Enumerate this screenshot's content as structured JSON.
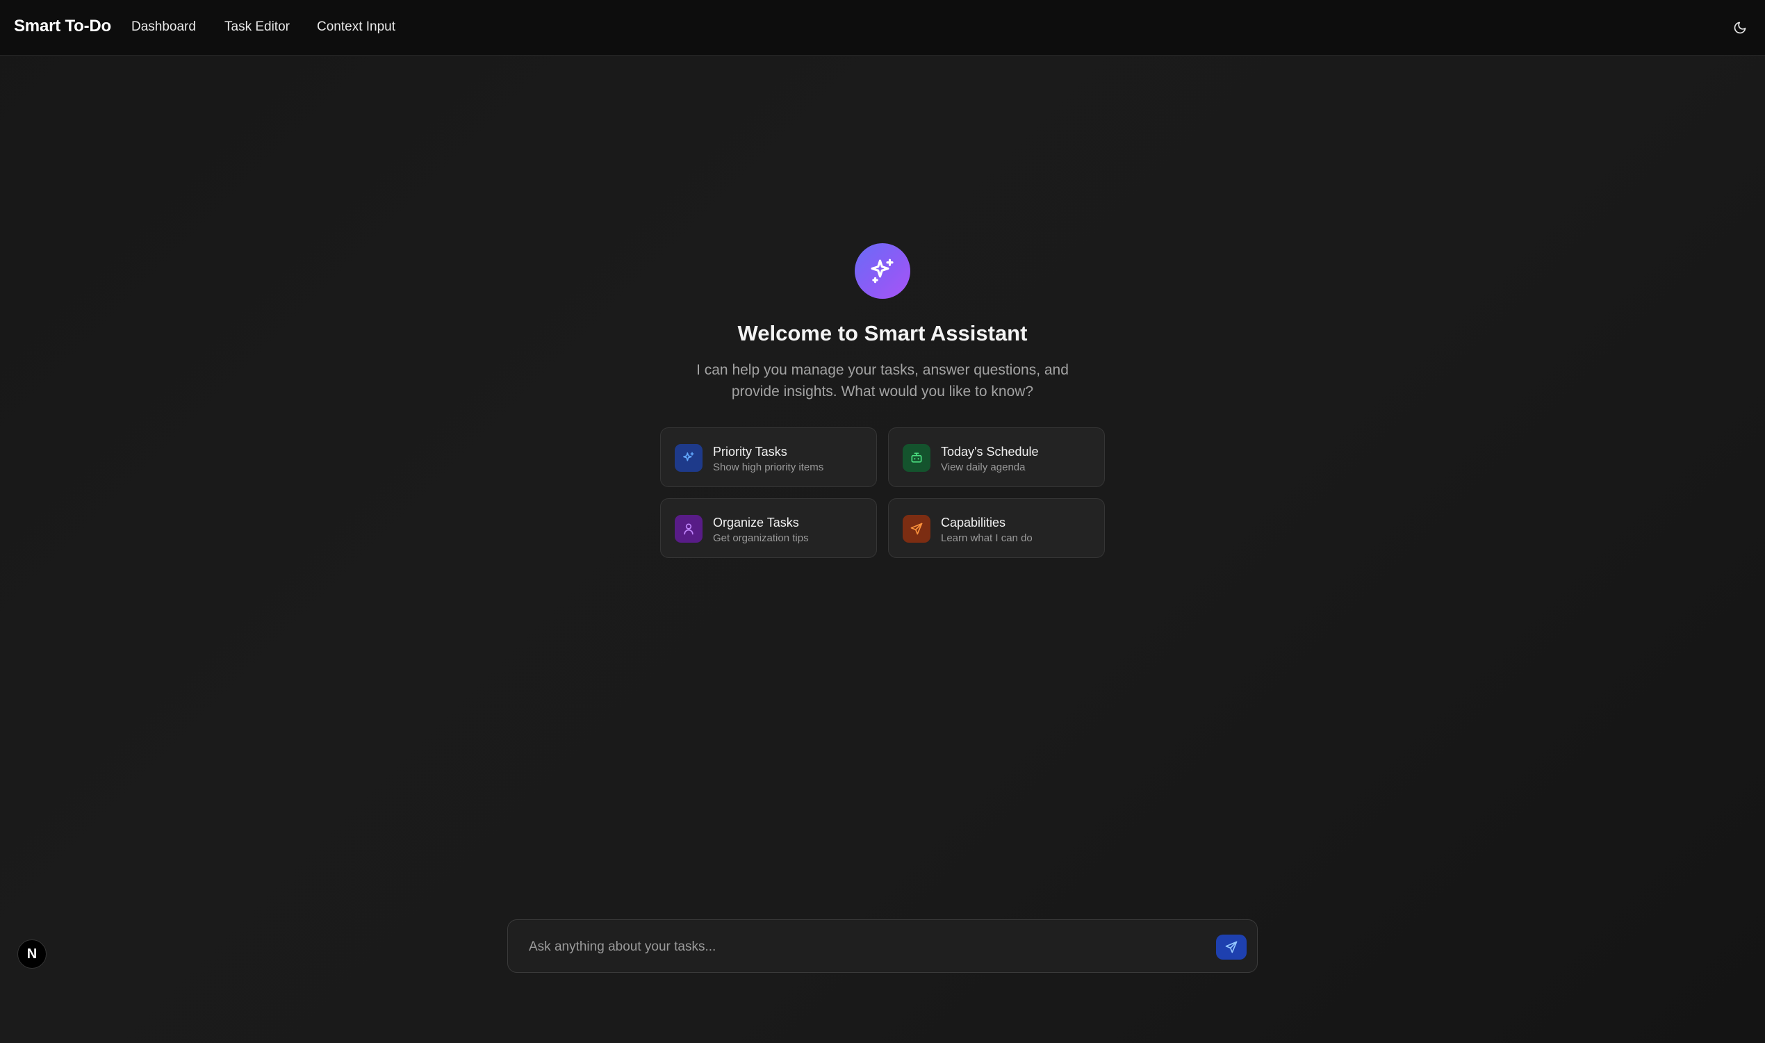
{
  "header": {
    "brand": "Smart To-Do",
    "nav": [
      {
        "label": "Dashboard"
      },
      {
        "label": "Task Editor"
      },
      {
        "label": "Context Input"
      }
    ],
    "theme_icon": "moon-icon"
  },
  "hero": {
    "icon": "sparkles-icon",
    "title": "Welcome to Smart Assistant",
    "subtitle": "I can help you manage your tasks, answer questions, and provide insights. What would you like to know?"
  },
  "suggestions": [
    {
      "title": "Priority Tasks",
      "description": "Show high priority items",
      "icon": "sparkles-icon",
      "color": "#60a5fa"
    },
    {
      "title": "Today's Schedule",
      "description": "View daily agenda",
      "icon": "bot-icon",
      "color": "#4ade80"
    },
    {
      "title": "Organize Tasks",
      "description": "Get organization tips",
      "icon": "user-icon",
      "color": "#c084fc"
    },
    {
      "title": "Capabilities",
      "description": "Learn what I can do",
      "icon": "send-icon",
      "color": "#fb923c"
    }
  ],
  "chat": {
    "placeholder": "Ask anything about your tasks...",
    "value": "",
    "send_icon": "send-icon"
  },
  "badge": {
    "label": "N"
  }
}
